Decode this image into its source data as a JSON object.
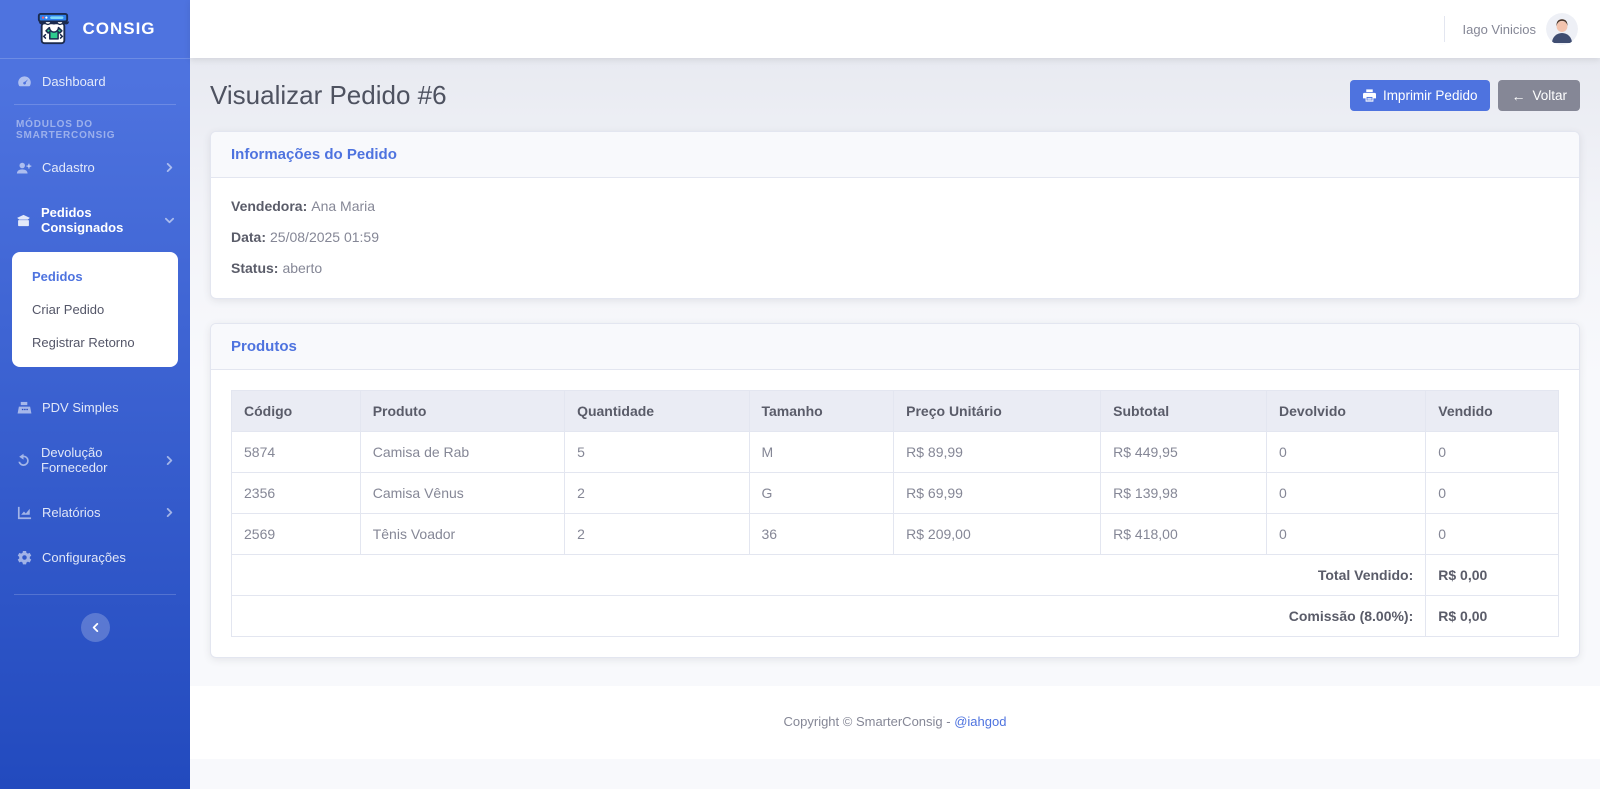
{
  "brand": {
    "name": "CONSIG"
  },
  "sidebar": {
    "section_label": "Módulos do SmarterConsig",
    "items": [
      {
        "label": "Dashboard",
        "icon": "tachometer-icon"
      },
      {
        "label": "Cadastro",
        "icon": "user-plus-icon",
        "chevron": "right"
      },
      {
        "label": "Pedidos Consignados",
        "icon": "box-icon",
        "chevron": "down",
        "active": true
      },
      {
        "label": "PDV Simples",
        "icon": "cash-register-icon"
      },
      {
        "label": "Devolução Fornecedor",
        "icon": "undo-icon",
        "chevron": "right"
      },
      {
        "label": "Relatórios",
        "icon": "chart-line-icon",
        "chevron": "right"
      },
      {
        "label": "Configurações",
        "icon": "gear-icon"
      }
    ],
    "submenu": [
      "Pedidos",
      "Criar Pedido",
      "Registrar Retorno"
    ]
  },
  "topbar": {
    "user_name": "Iago Vinicios"
  },
  "page": {
    "title": "Visualizar Pedido #6",
    "print_button": "Imprimir Pedido",
    "back_button": "Voltar",
    "back_arrow": "←"
  },
  "order_info": {
    "card_title": "Informações do Pedido",
    "fields": [
      {
        "label": "Vendedora:",
        "value": "Ana Maria"
      },
      {
        "label": "Data:",
        "value": "25/08/2025 01:59"
      },
      {
        "label": "Status:",
        "value": "aberto"
      }
    ]
  },
  "products": {
    "card_title": "Produtos",
    "columns": [
      "Código",
      "Produto",
      "Quantidade",
      "Tamanho",
      "Preço Unitário",
      "Subtotal",
      "Devolvido",
      "Vendido"
    ],
    "rows": [
      [
        "5874",
        "Camisa de Rab",
        "5",
        "M",
        "R$ 89,99",
        "R$ 449,95",
        "0",
        "0"
      ],
      [
        "2356",
        "Camisa Vênus",
        "2",
        "G",
        "R$ 69,99",
        "R$ 139,98",
        "0",
        "0"
      ],
      [
        "2569",
        "Tênis Voador",
        "2",
        "36",
        "R$ 209,00",
        "R$ 418,00",
        "0",
        "0"
      ]
    ],
    "totals": [
      {
        "label": "Total Vendido:",
        "value": "R$ 0,00"
      },
      {
        "label": "Comissão (8.00%):",
        "value": "R$ 0,00"
      }
    ]
  },
  "footer": {
    "copyright": "Copyright © SmarterConsig -",
    "link": "@iahgod"
  },
  "colors": {
    "primary": "#4e73df",
    "sidebar_gradient_top": "#4e73df",
    "sidebar_gradient_bottom": "#224abe",
    "secondary_button": "#858796",
    "text_gray": "#858796",
    "heading_gray": "#5a5c69",
    "border": "#e3e6f0",
    "table_header_bg": "#eaecf4",
    "body_bg": "#f8f9fc"
  }
}
